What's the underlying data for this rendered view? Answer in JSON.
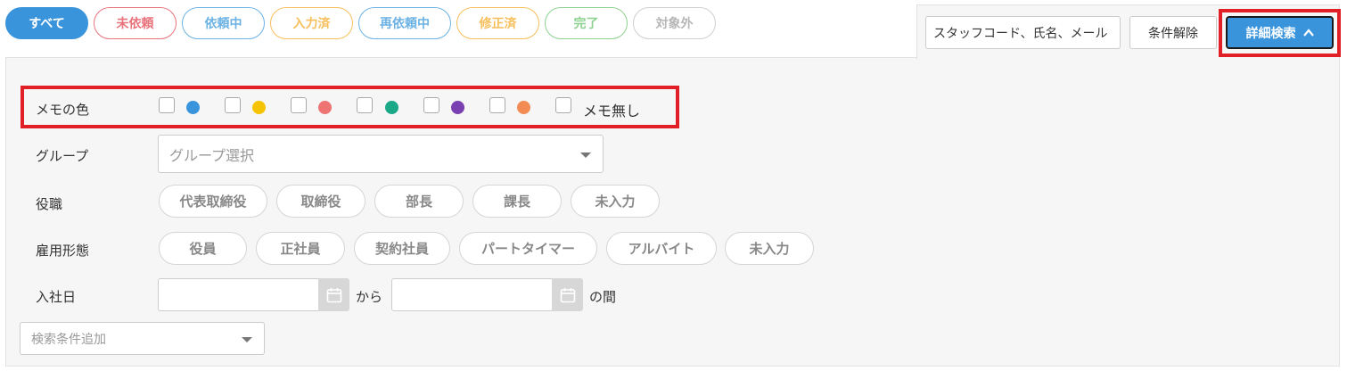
{
  "status_filters": [
    {
      "label": "すべて",
      "color": "#3a94dc",
      "active": true
    },
    {
      "label": "未依頼",
      "color": "#e8737b"
    },
    {
      "label": "依頼中",
      "color": "#6cb2e4"
    },
    {
      "label": "入力済",
      "color": "#f7bf5b"
    },
    {
      "label": "再依頼中",
      "color": "#6cb2e4"
    },
    {
      "label": "修正済",
      "color": "#f7bf5b"
    },
    {
      "label": "完了",
      "color": "#8cd18f"
    },
    {
      "label": "対象外",
      "color": "#b6b6b6"
    }
  ],
  "search": {
    "value": "スタッフコード、氏名、メール"
  },
  "clear_button": "条件解除",
  "advanced_button": {
    "label": "詳細検索",
    "icon": "chevron-up-icon"
  },
  "memo": {
    "label": "メモの色",
    "colors": [
      "#3a94dc",
      "#f5c300",
      "#ee7474",
      "#1aa889",
      "#7a3fb0",
      "#f38b55"
    ],
    "none_label": "メモ無し"
  },
  "group": {
    "label": "グループ",
    "placeholder": "グループ選択"
  },
  "position": {
    "label": "役職",
    "options": [
      "代表取締役",
      "取締役",
      "部長",
      "課長",
      "未入力"
    ]
  },
  "employment": {
    "label": "雇用形態",
    "options": [
      "役員",
      "正社員",
      "契約社員",
      "パートタイマー",
      "アルバイト",
      "未入力"
    ]
  },
  "hire_date": {
    "label": "入社日",
    "from_text": "から",
    "between_text": "の間"
  },
  "add_condition": {
    "placeholder": "検索条件追加"
  }
}
